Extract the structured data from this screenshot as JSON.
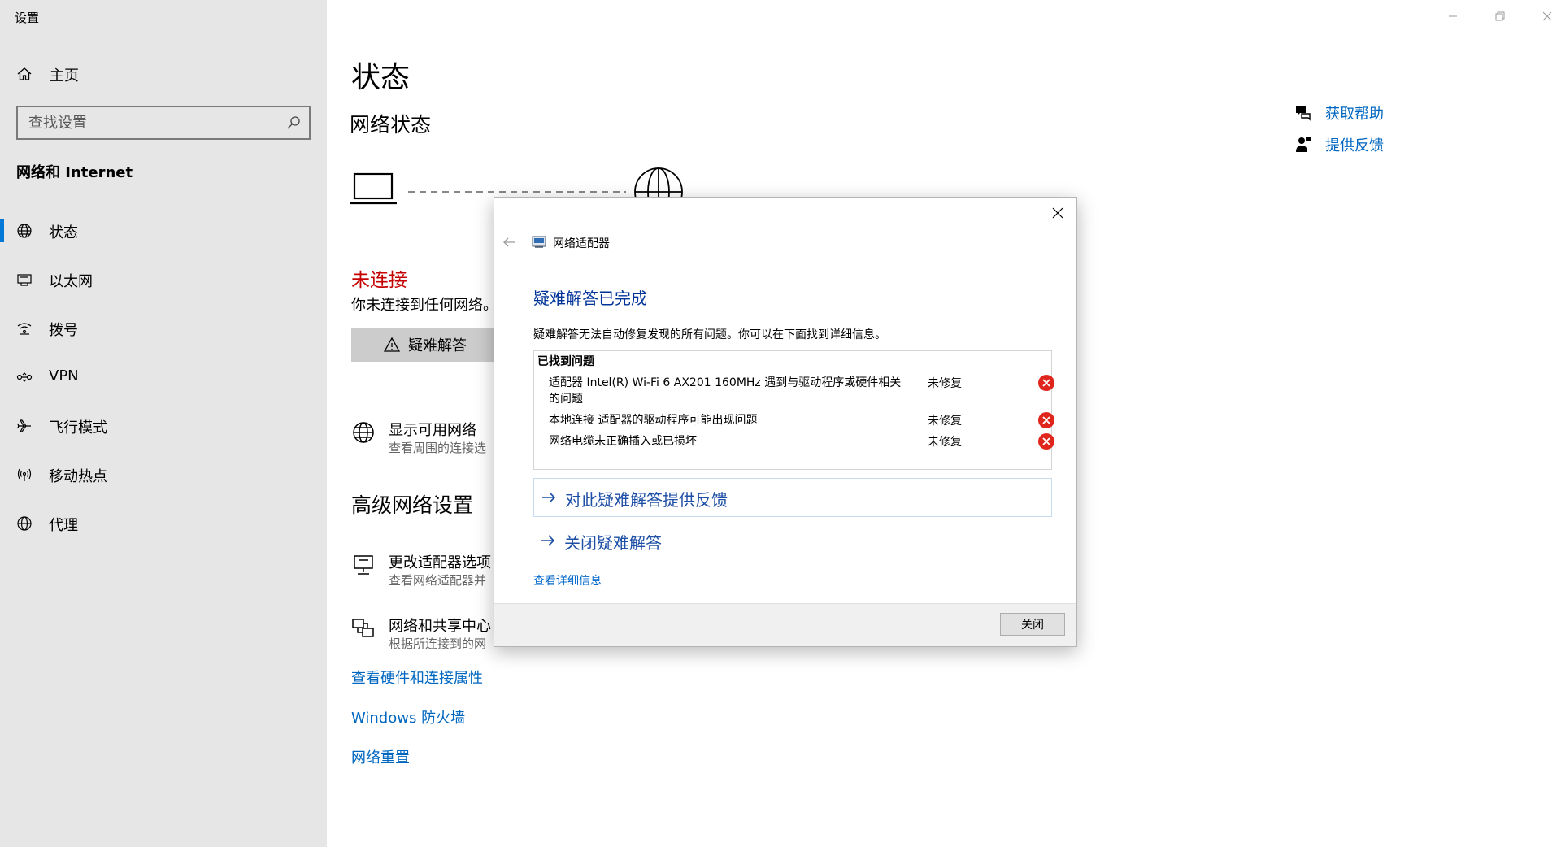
{
  "window": {
    "title": "设置"
  },
  "sidebar": {
    "home_label": "主页",
    "search_placeholder": "查找设置",
    "section_title": "网络和 Internet",
    "items": [
      {
        "label": "状态",
        "icon": "globe-status-icon",
        "active": true
      },
      {
        "label": "以太网",
        "icon": "ethernet-icon"
      },
      {
        "label": "拨号",
        "icon": "dial-up-icon"
      },
      {
        "label": "VPN",
        "icon": "vpn-icon"
      },
      {
        "label": "飞行模式",
        "icon": "airplane-icon"
      },
      {
        "label": "移动热点",
        "icon": "hotspot-icon"
      },
      {
        "label": "代理",
        "icon": "proxy-globe-icon"
      }
    ]
  },
  "main": {
    "title": "状态",
    "network_status_title": "网络状态",
    "status_text": "未连接",
    "status_sub": "你未连接到任何网络。",
    "troubleshoot_label": "疑难解答",
    "show_networks": {
      "title": "显示可用网络",
      "subtitle": "查看周围的连接选"
    },
    "advanced_title": "高级网络设置",
    "change_adapter": {
      "title": "更改适配器选项",
      "subtitle": "查看网络适配器并"
    },
    "sharing_center": {
      "title": "网络和共享中心",
      "subtitle": "根据所连接到的网"
    },
    "links": [
      "查看硬件和连接属性",
      "Windows 防火墙",
      "网络重置"
    ],
    "help": {
      "get_help": "获取帮助",
      "feedback": "提供反馈"
    }
  },
  "dialog": {
    "app_title": "网络适配器",
    "heading": "疑难解答已完成",
    "description": "疑难解答无法自动修复发现的所有问题。你可以在下面找到详细信息。",
    "found_title": "已找到问题",
    "problems": [
      {
        "desc": "适配器 Intel(R) Wi-Fi 6 AX201 160MHz 遇到与驱动程序或硬件相关的问题",
        "status": "未修复"
      },
      {
        "desc": "本地连接 适配器的驱动程序可能出现问题",
        "status": "未修复"
      },
      {
        "desc": "网络电缆未正确插入或已损坏",
        "status": "未修复"
      }
    ],
    "cmd_feedback": "对此疑难解答提供反馈",
    "cmd_close": "关闭疑难解答",
    "details_link": "查看详细信息",
    "close_button": "关闭"
  },
  "colors": {
    "accent": "#0078d7",
    "link": "#0067c0",
    "error": "#c50000",
    "dialog_heading": "#003399"
  }
}
